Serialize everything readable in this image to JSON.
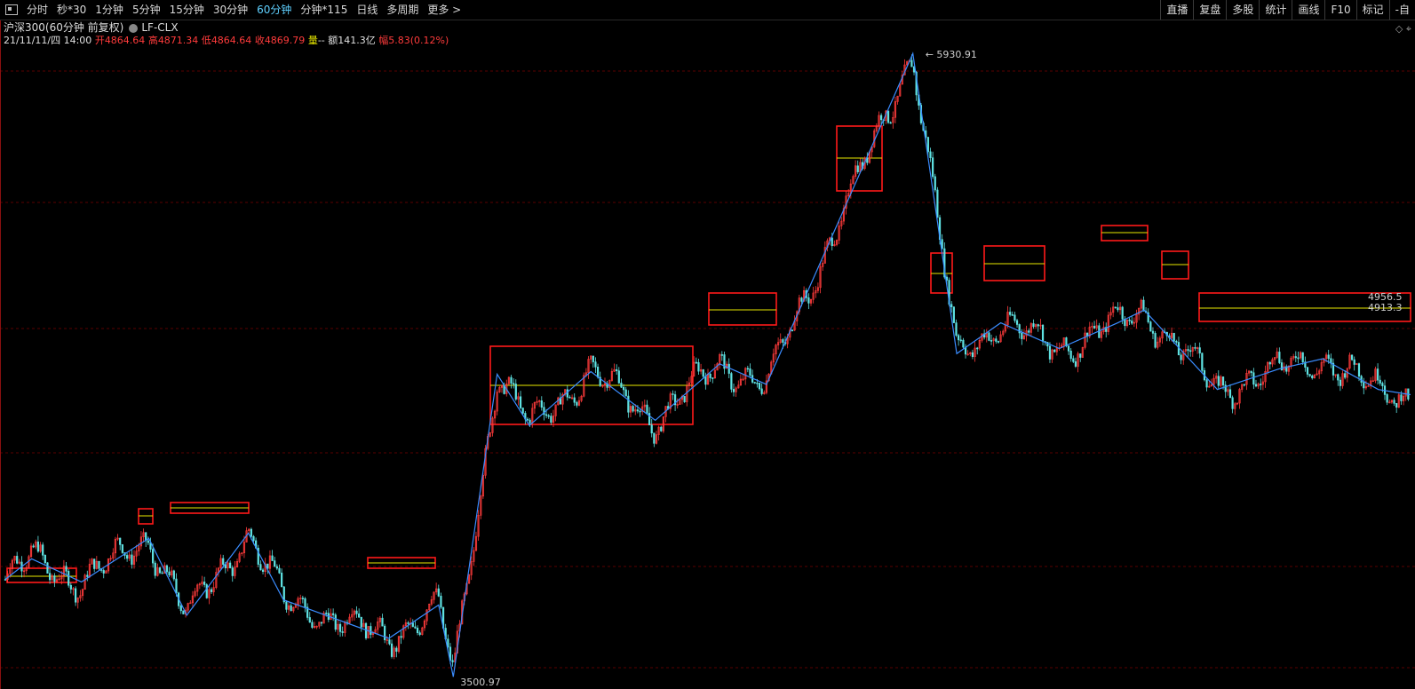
{
  "tabs": [
    {
      "label": "分时",
      "active": false
    },
    {
      "label": "秒*30",
      "active": false
    },
    {
      "label": "1分钟",
      "active": false
    },
    {
      "label": "5分钟",
      "active": false
    },
    {
      "label": "15分钟",
      "active": false
    },
    {
      "label": "30分钟",
      "active": false
    },
    {
      "label": "60分钟",
      "active": true
    },
    {
      "label": "分钟*115",
      "active": false
    },
    {
      "label": "日线",
      "active": false
    },
    {
      "label": "多周期",
      "active": false
    },
    {
      "label": "更多 >",
      "active": false
    }
  ],
  "right_tools": [
    "直播",
    "复盘",
    "多股",
    "统计",
    "画线",
    "F10",
    "标记",
    "-自"
  ],
  "header": {
    "symbol": "沪深300(60分钟 前复权)",
    "indicator": "LF-CLX",
    "datetime": "21/11/11/四 14:00",
    "open_label": "开",
    "open": "4864.64",
    "high_label": "高",
    "high": "4871.34",
    "low_label": "低",
    "low": "4864.64",
    "close_label": "收",
    "close": "4869.79",
    "vol_label": "量",
    "vol": "--",
    "amount_label": "额",
    "amount": "141.3亿",
    "range_label": "幅",
    "range": "5.83(0.12%)"
  },
  "colors": {
    "background": "#000000",
    "up": "#ff3b3b",
    "down": "#5fe3e3",
    "zigzag": "#3a8cff",
    "pivot_box": "#ff1a1a",
    "midline": "#e8e800",
    "grid": "#5a0000",
    "active_tab": "#5fd0ff"
  },
  "chart_data": {
    "type": "line",
    "series_kind": "candlestick + zigzag",
    "annotations": {
      "high_label": "5930.91",
      "low_label": "3500.97",
      "right_labels": [
        "4956.5",
        "4913.3"
      ]
    },
    "zigzag_pivots": [
      {
        "i": 0,
        "v": 3880
      },
      {
        "i": 18,
        "v": 3960
      },
      {
        "i": 52,
        "v": 3870
      },
      {
        "i": 98,
        "v": 4040
      },
      {
        "i": 124,
        "v": 3740
      },
      {
        "i": 166,
        "v": 4060
      },
      {
        "i": 190,
        "v": 3800
      },
      {
        "i": 306,
        "v": 3500
      },
      {
        "i": 262,
        "v": 3650
      },
      {
        "i": 296,
        "v": 3780
      },
      {
        "i": 336,
        "v": 4680
      },
      {
        "i": 358,
        "v": 4480
      },
      {
        "i": 400,
        "v": 4690
      },
      {
        "i": 444,
        "v": 4500
      },
      {
        "i": 488,
        "v": 4720
      },
      {
        "i": 520,
        "v": 4640
      },
      {
        "i": 620,
        "v": 5930
      },
      {
        "i": 650,
        "v": 4760
      },
      {
        "i": 680,
        "v": 4880
      },
      {
        "i": 720,
        "v": 4780
      },
      {
        "i": 760,
        "v": 4880
      },
      {
        "i": 778,
        "v": 4930
      },
      {
        "i": 828,
        "v": 4620
      },
      {
        "i": 870,
        "v": 4700
      },
      {
        "i": 900,
        "v": 4740
      },
      {
        "i": 938,
        "v": 4620
      },
      {
        "i": 960,
        "v": 4600
      }
    ]
  }
}
